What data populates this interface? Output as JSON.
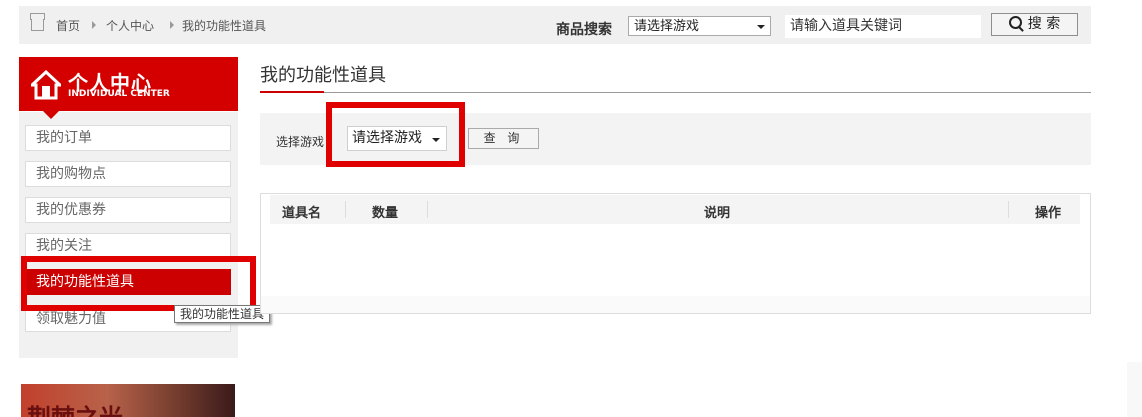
{
  "breadcrumb": {
    "home": "首页",
    "center": "个人中心",
    "current": "我的功能性道具"
  },
  "search": {
    "label": "商品搜索",
    "game_select": "请选择游戏",
    "keyword_placeholder": "请输入道具关键词",
    "button": "搜 索"
  },
  "banner": {
    "title": "个人中心",
    "subtitle": "INDIVIDUAL CENTER"
  },
  "sidebar": {
    "items": [
      {
        "label": "我的订单"
      },
      {
        "label": "我的购物点"
      },
      {
        "label": "我的优惠券"
      },
      {
        "label": "我的关注"
      },
      {
        "label": "我的功能性道具"
      },
      {
        "label": "领取魅力值"
      }
    ],
    "tooltip": "我的功能性道具"
  },
  "ad": {
    "text": "荆棘之光"
  },
  "main": {
    "title": "我的功能性道具",
    "filter": {
      "label": "选择游戏",
      "select": "请选择游戏",
      "query_button": "查 询"
    },
    "table": {
      "columns": [
        "道具名",
        "数量",
        "说明",
        "操作"
      ]
    }
  },
  "colors": {
    "accent": "#cc0000",
    "highlight_box": "#e00000"
  }
}
